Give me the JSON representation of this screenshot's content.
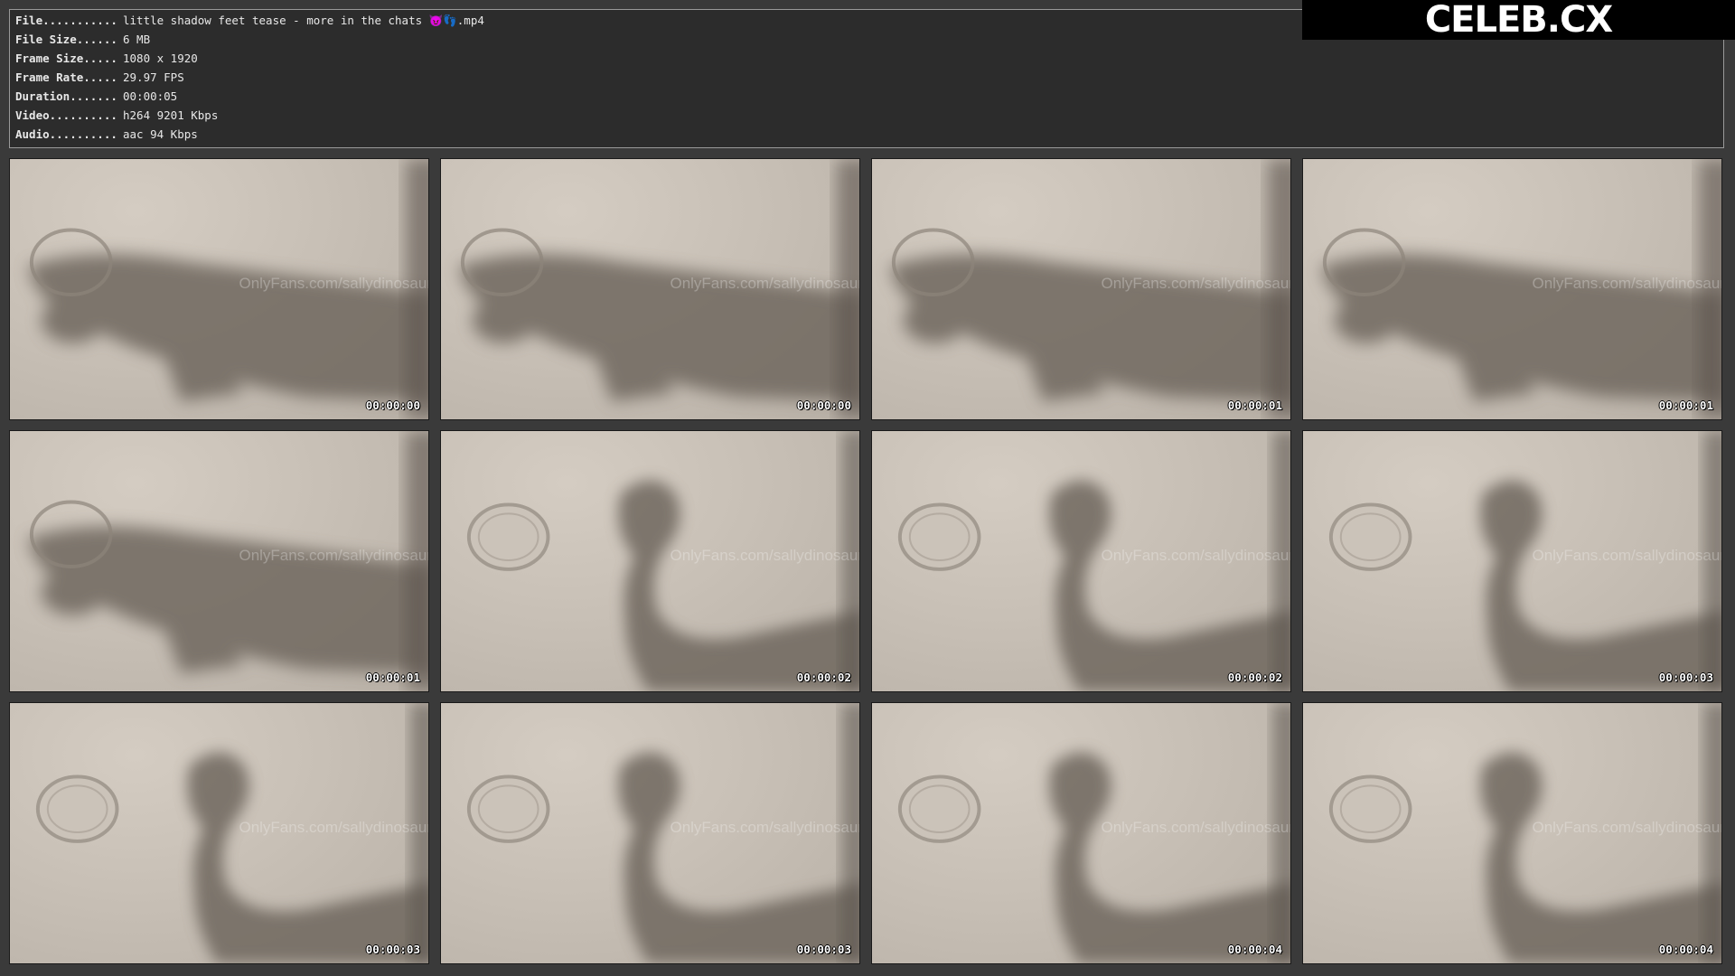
{
  "info": {
    "file_label": "File...........",
    "file_value": "little shadow feet tease - more in the chats 😈👣.mp4",
    "size_label": "File Size......",
    "size_value": "6 MB",
    "frame_size_label": "Frame Size.....",
    "frame_size_value": "1080 x 1920",
    "frame_rate_label": "Frame Rate.....",
    "frame_rate_value": "29.97 FPS",
    "duration_label": "Duration.......",
    "duration_value": "00:00:05",
    "video_label": "Video..........",
    "video_value": "h264 9201 Kbps",
    "audio_label": "Audio..........",
    "audio_value": "aac 94 Kbps"
  },
  "logo": {
    "text": "CELEB.CX"
  },
  "watermark": "OnlyFans.com/sallydinosaur",
  "thumbnails": [
    {
      "timestamp": "00:00:00",
      "scene": "leg"
    },
    {
      "timestamp": "00:00:00",
      "scene": "leg"
    },
    {
      "timestamp": "00:00:01",
      "scene": "leg"
    },
    {
      "timestamp": "00:00:01",
      "scene": "leg"
    },
    {
      "timestamp": "00:00:01",
      "scene": "leg"
    },
    {
      "timestamp": "00:00:02",
      "scene": "foot"
    },
    {
      "timestamp": "00:00:02",
      "scene": "foot"
    },
    {
      "timestamp": "00:00:03",
      "scene": "foot"
    },
    {
      "timestamp": "00:00:03",
      "scene": "foot"
    },
    {
      "timestamp": "00:00:03",
      "scene": "foot"
    },
    {
      "timestamp": "00:00:04",
      "scene": "foot"
    },
    {
      "timestamp": "00:00:04",
      "scene": "foot"
    }
  ]
}
